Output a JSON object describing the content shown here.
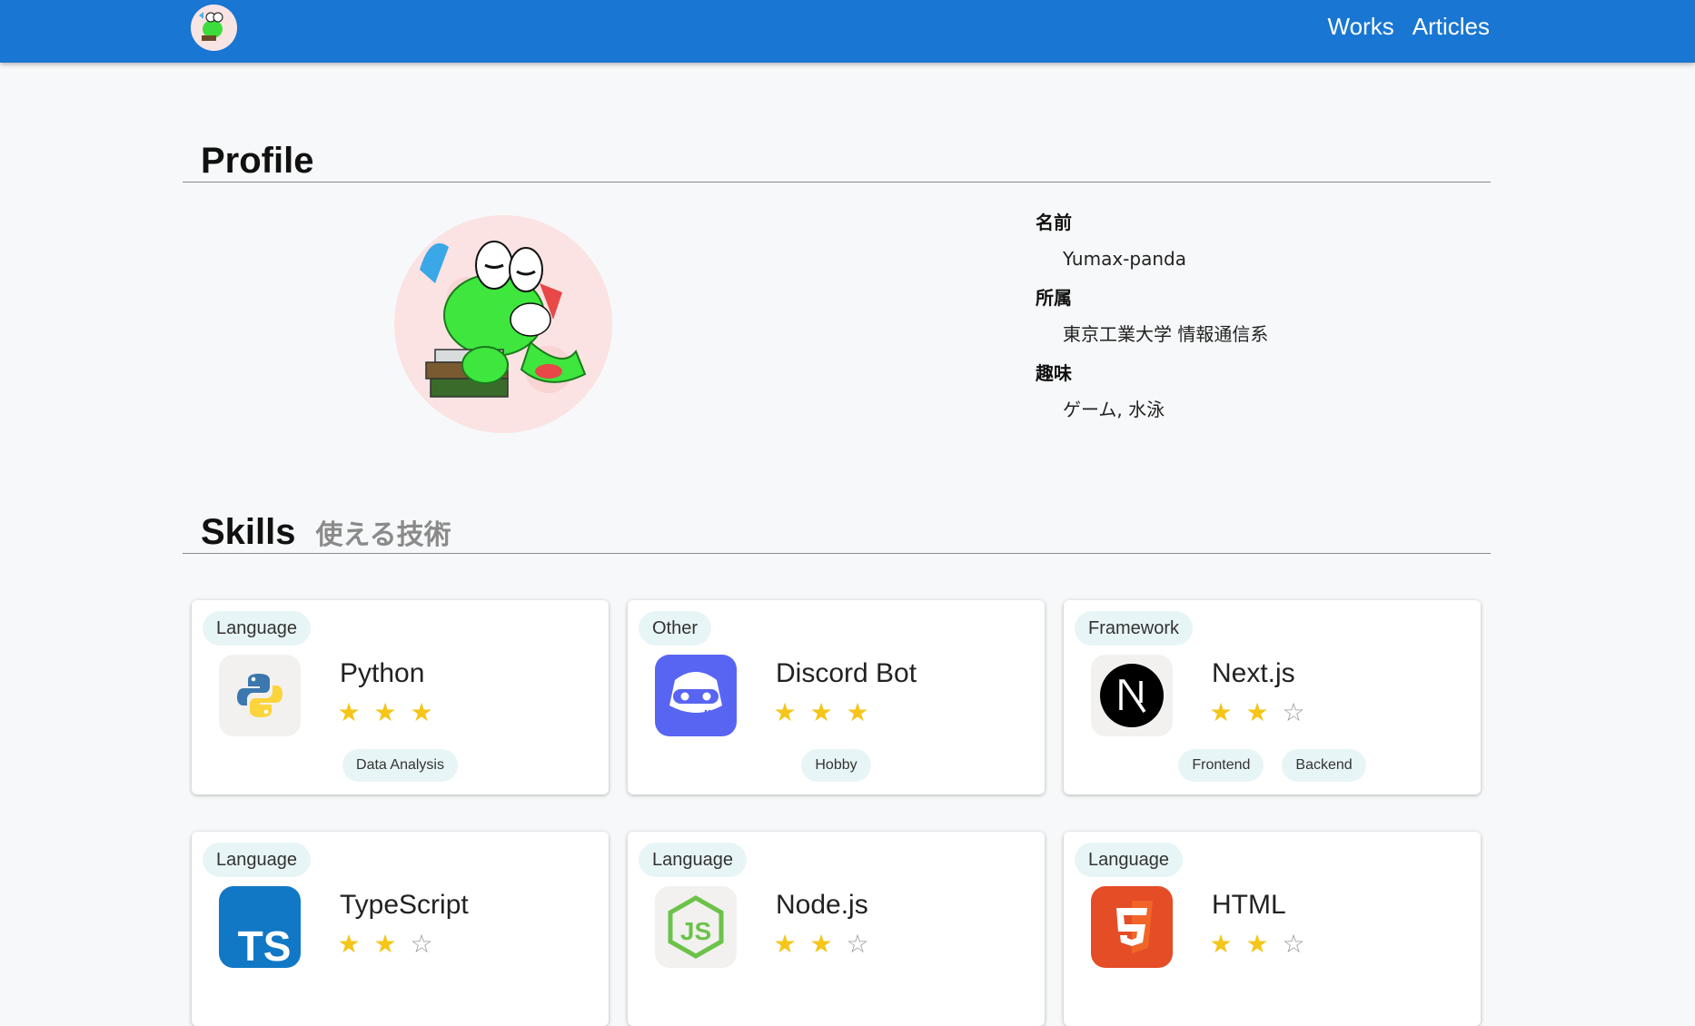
{
  "nav": {
    "works": "Works",
    "articles": "Articles"
  },
  "profile": {
    "title": "Profile",
    "fields": [
      {
        "label": "名前",
        "value": "Yumax-panda"
      },
      {
        "label": "所属",
        "value": "東京工業大学 情報通信系"
      },
      {
        "label": "趣味",
        "value": "ゲーム, 水泳"
      }
    ]
  },
  "skills": {
    "title": "Skills",
    "subtitle": "使える技術",
    "cards": [
      {
        "category": "Language",
        "name": "Python",
        "icon": "python-icon",
        "rating": 3,
        "max": 3,
        "tags": [
          "Data Analysis"
        ]
      },
      {
        "category": "Other",
        "name": "Discord Bot",
        "icon": "discord-icon",
        "rating": 3,
        "max": 3,
        "tags": [
          "Hobby"
        ]
      },
      {
        "category": "Framework",
        "name": "Next.js",
        "icon": "nextjs-icon",
        "rating": 2,
        "max": 3,
        "tags": [
          "Frontend",
          "Backend"
        ]
      },
      {
        "category": "Language",
        "name": "TypeScript",
        "icon": "typescript-icon",
        "rating": 2,
        "max": 3,
        "tags": []
      },
      {
        "category": "Language",
        "name": "Node.js",
        "icon": "nodejs-icon",
        "rating": 2,
        "max": 3,
        "tags": []
      },
      {
        "category": "Language",
        "name": "HTML",
        "icon": "html5-icon",
        "rating": 2,
        "max": 3,
        "tags": []
      }
    ]
  },
  "colors": {
    "appbar": "#1976d2",
    "star": "#f5c518",
    "chip": "#e8f5f6"
  }
}
